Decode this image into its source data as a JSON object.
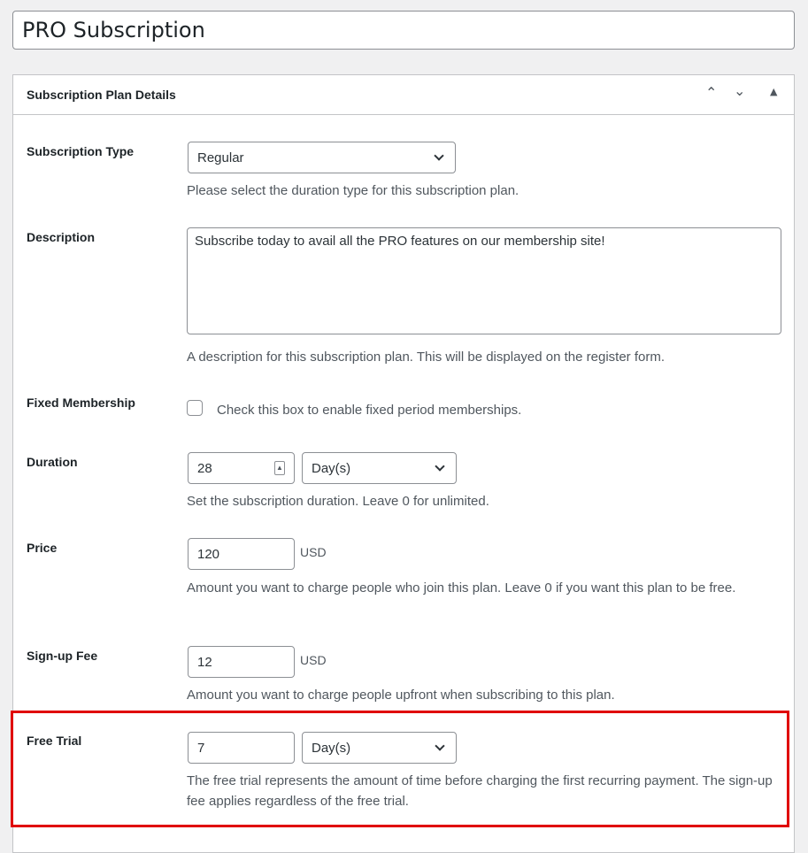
{
  "title": "PRO Subscription",
  "panel": {
    "title": "Subscription Plan Details",
    "controls": [
      "move-up",
      "move-down",
      "toggle"
    ]
  },
  "fields": {
    "type": {
      "label": "Subscription Type",
      "value": "Regular",
      "help": "Please select the duration type for this subscription plan."
    },
    "description": {
      "label": "Description",
      "value": "Subscribe today to avail all the PRO features on our membership site!",
      "help": "A description for this subscription plan. This will be displayed on the register form."
    },
    "fixed": {
      "label": "Fixed Membership",
      "checked": false,
      "text": "Check this box to enable fixed period memberships."
    },
    "duration": {
      "label": "Duration",
      "value": "28",
      "unit": "Day(s)",
      "help": "Set the subscription duration. Leave 0 for unlimited."
    },
    "price": {
      "label": "Price",
      "value": "120",
      "currency": "USD",
      "help": "Amount you want to charge people who join this plan. Leave 0 if you want this plan to be free."
    },
    "signup": {
      "label": "Sign-up Fee",
      "value": "12",
      "currency": "USD",
      "help": "Amount you want to charge people upfront when subscribing to this plan."
    },
    "trial": {
      "label": "Free Trial",
      "value": "7",
      "unit": "Day(s)",
      "help": "The free trial represents the amount of time before charging the first recurring payment. The sign-up fee applies regardless of the free trial."
    }
  },
  "highlight_color": "#e00000"
}
